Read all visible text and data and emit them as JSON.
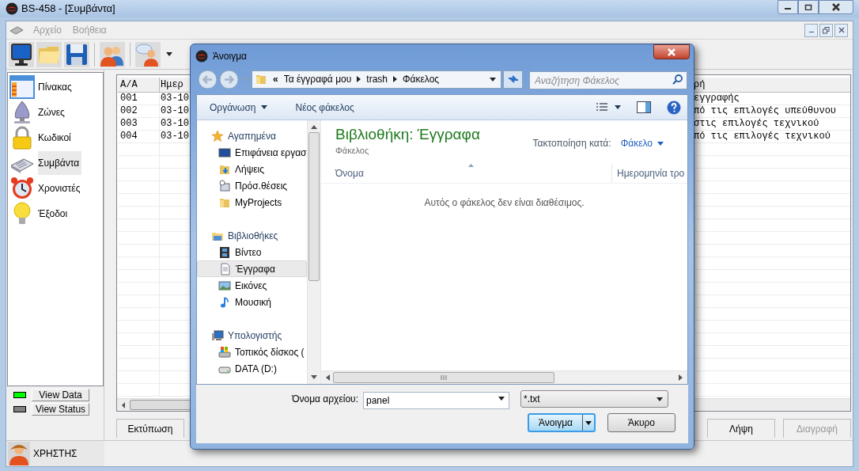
{
  "window": {
    "title": "BS-458 - [Συμβάντα]"
  },
  "menu": [
    {
      "label": "Αρχείο",
      "disabled": true
    },
    {
      "label": "Βοήθεια",
      "disabled": true
    }
  ],
  "sidebar": {
    "items": [
      {
        "label": "Πίνακας",
        "selected": false
      },
      {
        "label": "Ζώνες",
        "selected": false
      },
      {
        "label": "Κωδικοί",
        "selected": false
      },
      {
        "label": "Συμβάντα",
        "selected": true
      },
      {
        "label": "Χρονιστές",
        "selected": false
      },
      {
        "label": "Έξοδοι",
        "selected": false
      }
    ]
  },
  "indicators": [
    {
      "label": "View Data",
      "color": "#00ff00"
    },
    {
      "label": "View Status",
      "color": "#808080"
    }
  ],
  "user": {
    "label": "ΧΡΗΣΤΗΣ"
  },
  "table": {
    "columns": [
      "A/A",
      "Ημερ",
      "ρή"
    ],
    "rows": [
      [
        "001",
        "03-10",
        "εγγραφής"
      ],
      [
        "002",
        "03-10",
        "πό τις επιλογές υπεύθυνου"
      ],
      [
        "003",
        "03-10",
        "στις επιλογές τεχνικού"
      ],
      [
        "004",
        "03-10",
        "πό τις επιλογές τεχνικού"
      ]
    ]
  },
  "actions": [
    {
      "label": "Εκτύπωση",
      "disabled": false
    },
    {
      "label": "Λήψη",
      "disabled": false
    },
    {
      "label": "Διαγραφή",
      "disabled": true
    }
  ],
  "dialog": {
    "title": "Άνοιγμα",
    "breadcrumb": {
      "overflow": "«",
      "segments": [
        "Τα έγγραφά μου",
        "trash",
        "Φάκελος"
      ]
    },
    "search": {
      "placeholder": "Αναζήτηση Φάκελος"
    },
    "commands": [
      {
        "label": "Οργάνωση",
        "menu": true
      },
      {
        "label": "Νέος φάκελος",
        "menu": false
      }
    ],
    "nav": [
      {
        "label": "Αγαπημένα",
        "selected": false,
        "children": [
          {
            "label": "Επιφάνεια εργασ",
            "selected": false
          },
          {
            "label": "Λήψεις",
            "selected": false
          },
          {
            "label": "Πρόσ.θέσεις",
            "selected": false
          },
          {
            "label": "MyProjects",
            "selected": false
          }
        ]
      },
      {
        "label": "Βιβλιοθήκες",
        "selected": false,
        "children": [
          {
            "label": "Βίντεο",
            "selected": false
          },
          {
            "label": "Έγγραφα",
            "selected": true
          },
          {
            "label": "Εικόνες",
            "selected": false
          },
          {
            "label": "Μουσική",
            "selected": false
          }
        ]
      },
      {
        "label": "Υπολογιστής",
        "selected": false,
        "children": [
          {
            "label": "Τοπικός δίσκος (",
            "selected": false
          },
          {
            "label": "DATA (D:)",
            "selected": false
          }
        ]
      }
    ],
    "library": {
      "title": "Βιβλιοθήκη: Έγγραφα",
      "subtitle": "Φάκελος",
      "arrange_label": "Τακτοποίηση κατά:",
      "arrange_value": "Φάκελο"
    },
    "columns": [
      "Όνομα",
      "Ημερομηνία τρο"
    ],
    "empty_message": "Αυτός ο φάκελος δεν είναι διαθέσιμος.",
    "file_name": {
      "label": "Όνομα αρχείου:",
      "value": "panel"
    },
    "file_type": {
      "value": "*.txt"
    },
    "buttons": [
      {
        "label": "Άνοιγμα",
        "default": true
      },
      {
        "label": "Άκυρο",
        "default": false
      }
    ]
  }
}
